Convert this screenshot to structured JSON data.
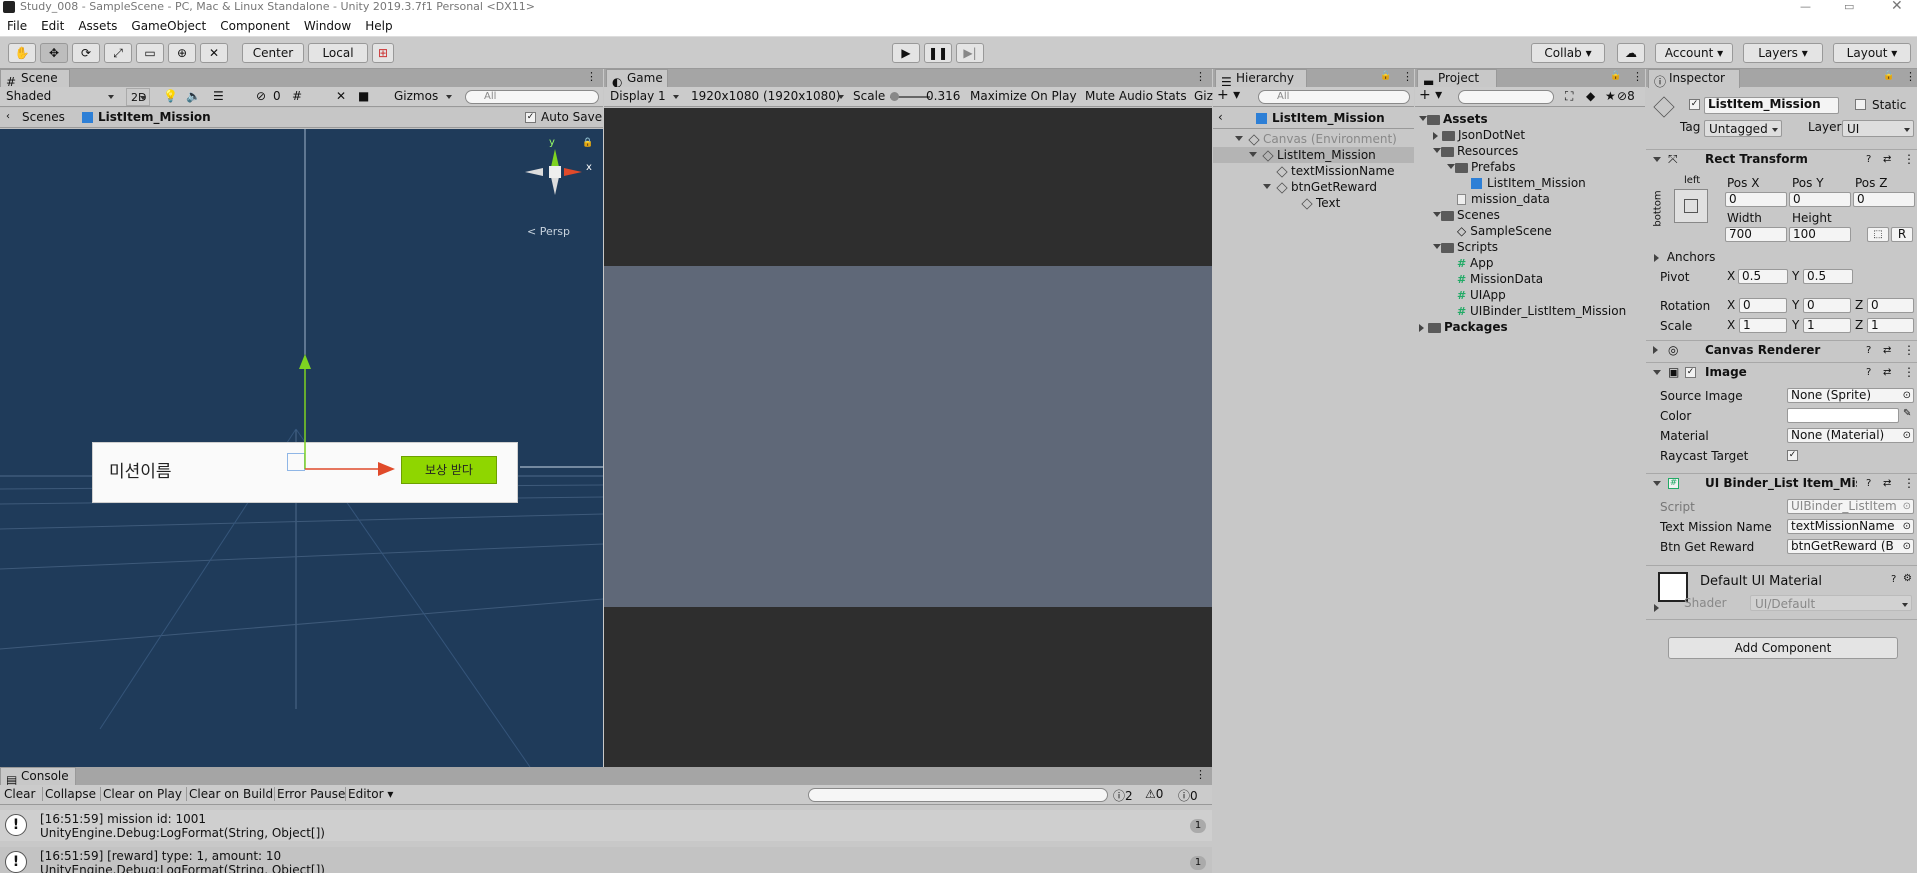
{
  "window": {
    "title": "Study_008 - SampleScene - PC, Mac & Linux Standalone - Unity 2019.3.7f1 Personal <DX11>"
  },
  "menu": [
    "File",
    "Edit",
    "Assets",
    "GameObject",
    "Component",
    "Window",
    "Help"
  ],
  "toolbar": {
    "pivot": "Center",
    "space": "Local",
    "collab": "Collab",
    "account": "Account",
    "layers": "Layers",
    "layout": "Layout"
  },
  "scene": {
    "tab": "Scene",
    "shading": "Shaded",
    "mode2d": "2D",
    "hidden_count": "0",
    "gizmos": "Gizmos",
    "search_placeholder": "All",
    "breadcrumb_root": "Scenes",
    "breadcrumb_item": "ListItem_Mission",
    "auto_save": "Auto Save",
    "persp": "Persp",
    "axis_y": "y",
    "axis_x": "x",
    "item_text": "미션이름",
    "item_button": "보상 받다"
  },
  "game": {
    "tab": "Game",
    "display": "Display 1",
    "resolution": "1920x1080 (1920x1080)",
    "scale_label": "Scale",
    "scale_value": "0.316",
    "maximize": "Maximize On Play",
    "mute": "Mute Audio",
    "stats": "Stats",
    "gizmos": "Giz"
  },
  "hierarchy": {
    "tab": "Hierarchy",
    "search_placeholder": "All",
    "root": "ListItem_Mission",
    "items": [
      "Canvas (Environment)",
      "ListItem_Mission",
      "textMissionName",
      "btnGetReward",
      "Text"
    ]
  },
  "project": {
    "tab": "Project",
    "count": "8",
    "items": [
      "Assets",
      "JsonDotNet",
      "Resources",
      "Prefabs",
      "ListItem_Mission",
      "mission_data",
      "Scenes",
      "SampleScene",
      "Scripts",
      "App",
      "MissionData",
      "UIApp",
      "UIBinder_ListItem_Mission",
      "Packages"
    ]
  },
  "inspector": {
    "tab": "Inspector",
    "name": "ListItem_Mission",
    "static": "Static",
    "tag_label": "Tag",
    "tag": "Untagged",
    "layer_label": "Layer",
    "layer": "UI",
    "rect_transform": "Rect Transform",
    "anchor_left": "left",
    "anchor_bottom": "bottom",
    "posx_label": "Pos X",
    "posy_label": "Pos Y",
    "posz_label": "Pos Z",
    "posx": "0",
    "posy": "0",
    "posz": "0",
    "width_label": "Width",
    "height_label": "Height",
    "width": "700",
    "height": "100",
    "r_btn": "R",
    "anchors": "Anchors",
    "pivot": "Pivot",
    "pivot_x": "0.5",
    "pivot_y": "0.5",
    "rotation": "Rotation",
    "rot_x": "0",
    "rot_y": "0",
    "rot_z": "0",
    "scale": "Scale",
    "scale_x": "1",
    "scale_y": "1",
    "scale_z": "1",
    "x": "X",
    "y": "Y",
    "z": "Z",
    "canvas_renderer": "Canvas Renderer",
    "image": "Image",
    "source_image_label": "Source Image",
    "source_image": "None (Sprite)",
    "color_label": "Color",
    "material_label": "Material",
    "material": "None (Material)",
    "raycast_label": "Raycast Target",
    "binder": "UI Binder_List Item_Missi",
    "script_label": "Script",
    "script": "UIBinder_ListItem",
    "text_mission_label": "Text Mission Name",
    "text_mission": "textMissionName",
    "btn_reward_label": "Btn Get Reward",
    "btn_reward": "btnGetReward (B",
    "default_material": "Default UI Material",
    "shader_label": "Shader",
    "shader": "UI/Default",
    "add_component": "Add Component"
  },
  "console": {
    "tab": "Console",
    "buttons": [
      "Clear",
      "Collapse",
      "Clear on Play",
      "Clear on Build",
      "Error Pause",
      "Editor"
    ],
    "counts": [
      "2",
      "0",
      "0"
    ],
    "logs": [
      {
        "line1": "[16:51:59] mission id: 1001",
        "line2": "UnityEngine.Debug:LogFormat(String, Object[])",
        "count": "1"
      },
      {
        "line1": "[16:51:59] [reward] type: 1, amount: 10",
        "line2": "UnityEngine.Debug:LogFormat(String, Object[])",
        "count": "1"
      }
    ]
  },
  "colors": {
    "scene_bg": "#1f3b5a",
    "game_bg": "#5f6878",
    "game_bar": "#2e2e2e",
    "green_btn": "#8fd600",
    "selection": "#3a72c6"
  }
}
